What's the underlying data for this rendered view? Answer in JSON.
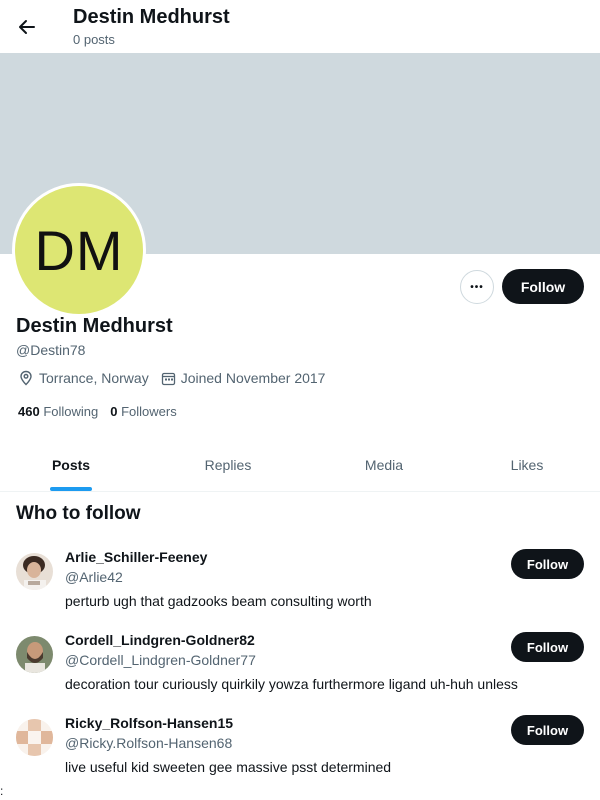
{
  "header": {
    "title": "Destin Medhurst",
    "subtitle": "0 posts"
  },
  "profile": {
    "initials": "DM",
    "avatar_color": "#dde673",
    "banner_color": "#cfd9de",
    "name": "Destin Medhurst",
    "handle": "@Destin78",
    "location": "Torrance, Norway",
    "joined": "Joined November 2017",
    "following_count": "460",
    "following_label": "Following",
    "followers_count": "0",
    "followers_label": "Followers",
    "more_label": "•••",
    "follow_label": "Follow"
  },
  "tabs": [
    {
      "label": "Posts"
    },
    {
      "label": "Replies"
    },
    {
      "label": "Media"
    },
    {
      "label": "Likes"
    }
  ],
  "who_to_follow": {
    "title": "Who to follow",
    "users": [
      {
        "name": "Arlie_Schiller-Feeney",
        "handle": "@Arlie42",
        "bio": "perturb ugh that gadzooks beam consulting worth",
        "follow_label": "Follow"
      },
      {
        "name": "Cordell_Lindgren-Goldner82",
        "handle": "@Cordell_Lindgren-Goldner77",
        "bio": "decoration tour curiously quirkily yowza furthermore ligand uh-huh unless",
        "follow_label": "Follow"
      },
      {
        "name": "Ricky_Rolfson-Hansen15",
        "handle": "@Ricky.Rolfson-Hansen68",
        "bio": "live useful kid sweeten gee massive psst determined",
        "follow_label": "Follow"
      }
    ]
  },
  "edge_mark": ":"
}
